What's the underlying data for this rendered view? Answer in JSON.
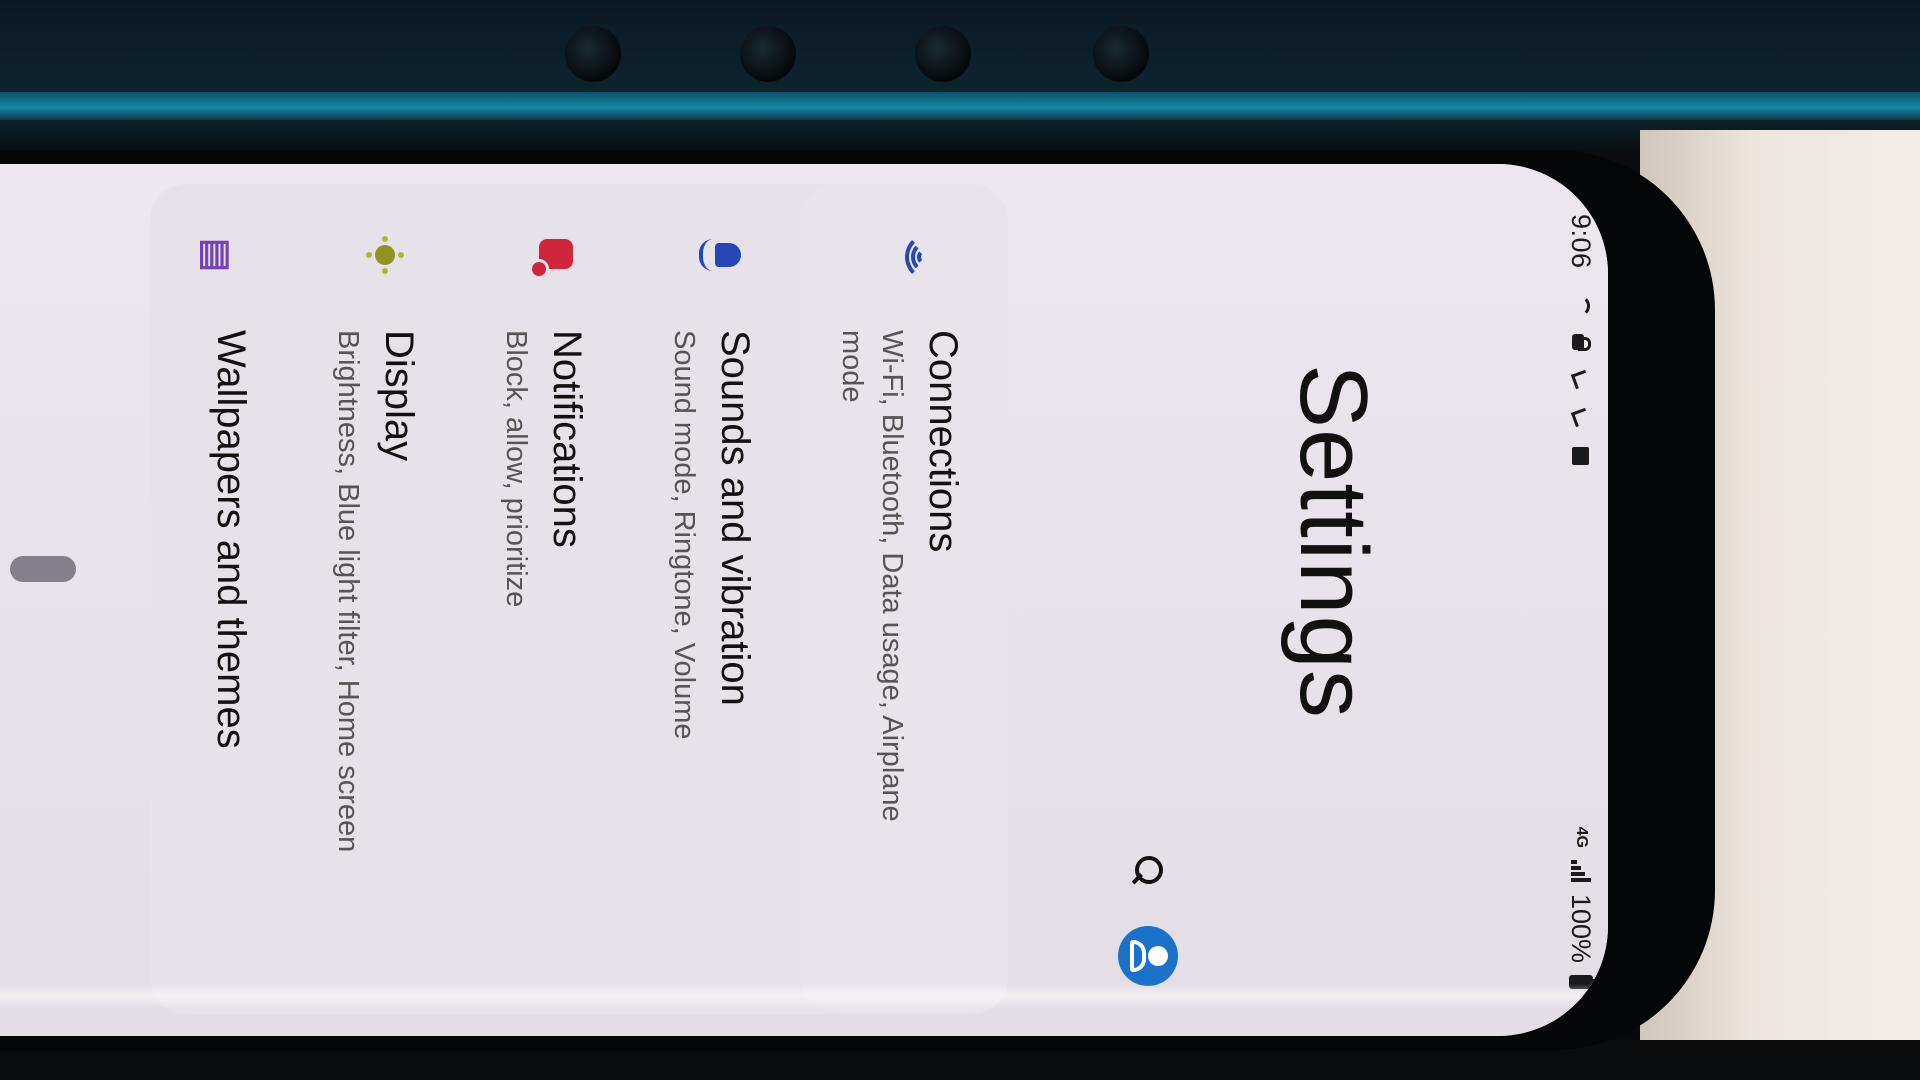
{
  "status_bar": {
    "time": "9:06",
    "network": "4G",
    "battery": "100%"
  },
  "header": {
    "title": "Settings"
  },
  "settings_items": [
    {
      "title": "Connections",
      "subtitle": "Wi-Fi, Bluetooth, Data usage, Airplane mode",
      "icon": "wifi-icon",
      "color": "#2746b8"
    },
    {
      "title": "Sounds and vibration",
      "subtitle": "Sound mode, Ringtone, Volume",
      "icon": "sound-icon",
      "color": "#2746b8"
    },
    {
      "title": "Notifications",
      "subtitle": "Block, allow, prioritize",
      "icon": "notification-icon",
      "color": "#d0263b"
    },
    {
      "title": "Display",
      "subtitle": "Brightness, Blue light filter, Home screen",
      "icon": "brightness-icon",
      "color": "#8f9423"
    },
    {
      "title": "Wallpapers and themes",
      "subtitle": "",
      "icon": "wallpaper-icon",
      "color": "#7442b8"
    }
  ],
  "colors": {
    "accent": "#1a73c8",
    "background": "#e6e0ea"
  }
}
